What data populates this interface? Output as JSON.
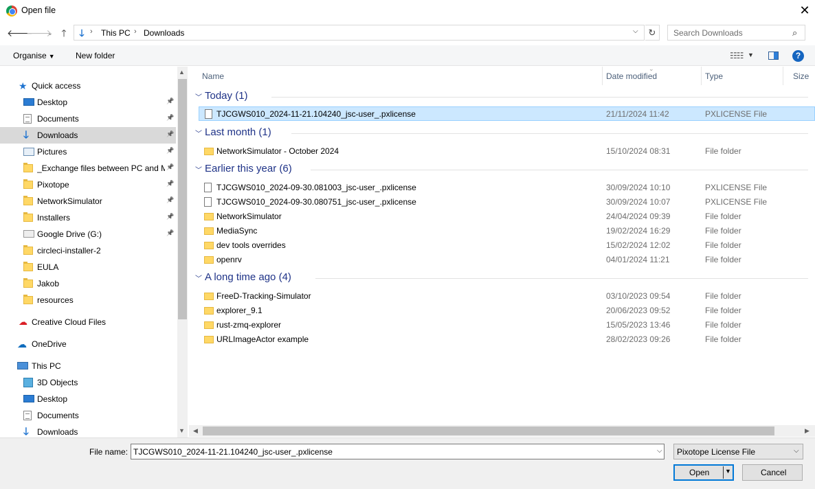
{
  "window": {
    "title": "Open file"
  },
  "nav": {
    "path": [
      "This PC",
      "Downloads"
    ],
    "search_placeholder": "Search Downloads"
  },
  "toolbar": {
    "organise": "Organise",
    "new_folder": "New folder"
  },
  "sidebar": {
    "items": [
      {
        "label": "Quick access",
        "icon": "star-icon",
        "pinned": false
      },
      {
        "label": "Desktop",
        "icon": "desktop-icon",
        "pinned": true
      },
      {
        "label": "Documents",
        "icon": "documents-icon",
        "pinned": true
      },
      {
        "label": "Downloads",
        "icon": "downloads-icon",
        "pinned": true
      },
      {
        "label": "Pictures",
        "icon": "pictures-icon",
        "pinned": true
      },
      {
        "label": "_Exchange files between PC and MA",
        "icon": "folder-icon",
        "pinned": true
      },
      {
        "label": "Pixotope",
        "icon": "folder-icon",
        "pinned": true
      },
      {
        "label": "NetworkSimulator",
        "icon": "folder-icon",
        "pinned": true
      },
      {
        "label": "Installers",
        "icon": "folder-icon",
        "pinned": true
      },
      {
        "label": "Google Drive (G:)",
        "icon": "google-drive-icon",
        "pinned": true
      },
      {
        "label": "circleci-installer-2",
        "icon": "folder-icon",
        "pinned": false
      },
      {
        "label": "EULA",
        "icon": "folder-icon",
        "pinned": false
      },
      {
        "label": "Jakob",
        "icon": "folder-icon",
        "pinned": false
      },
      {
        "label": "resources",
        "icon": "folder-icon",
        "pinned": false
      },
      {
        "label": "Creative Cloud Files",
        "icon": "creative-cloud-icon",
        "pinned": false
      },
      {
        "label": "OneDrive",
        "icon": "onedrive-icon",
        "pinned": false
      },
      {
        "label": "This PC",
        "icon": "this-pc-icon",
        "pinned": false
      },
      {
        "label": "3D Objects",
        "icon": "3d-objects-icon",
        "pinned": false
      },
      {
        "label": "Desktop",
        "icon": "desktop-icon",
        "pinned": false
      },
      {
        "label": "Documents",
        "icon": "documents-icon",
        "pinned": false
      },
      {
        "label": "Downloads",
        "icon": "downloads-icon",
        "pinned": false
      }
    ]
  },
  "columns": {
    "name": "Name",
    "date": "Date modified",
    "type": "Type",
    "size": "Size"
  },
  "groups": [
    {
      "label": "Today (1)",
      "files": [
        {
          "name": "TJCGWS010_2024-11-21.104240_jsc-user_.pxlicense",
          "date": "21/11/2024 11:42",
          "type": "PXLICENSE File",
          "kind": "file"
        }
      ]
    },
    {
      "label": "Last month (1)",
      "files": [
        {
          "name": "NetworkSimulator - October 2024",
          "date": "15/10/2024 08:31",
          "type": "File folder",
          "kind": "folder"
        }
      ]
    },
    {
      "label": "Earlier this year (6)",
      "files": [
        {
          "name": "TJCGWS010_2024-09-30.081003_jsc-user_.pxlicense",
          "date": "30/09/2024 10:10",
          "type": "PXLICENSE File",
          "kind": "file"
        },
        {
          "name": "TJCGWS010_2024-09-30.080751_jsc-user_.pxlicense",
          "date": "30/09/2024 10:07",
          "type": "PXLICENSE File",
          "kind": "file"
        },
        {
          "name": "NetworkSimulator",
          "date": "24/04/2024 09:39",
          "type": "File folder",
          "kind": "folder"
        },
        {
          "name": "MediaSync",
          "date": "19/02/2024 16:29",
          "type": "File folder",
          "kind": "folder"
        },
        {
          "name": "dev tools overrides",
          "date": "15/02/2024 12:02",
          "type": "File folder",
          "kind": "folder"
        },
        {
          "name": "openrv",
          "date": "04/01/2024 11:21",
          "type": "File folder",
          "kind": "folder"
        }
      ]
    },
    {
      "label": "A long time ago (4)",
      "files": [
        {
          "name": "FreeD-Tracking-Simulator",
          "date": "03/10/2023 09:54",
          "type": "File folder",
          "kind": "folder"
        },
        {
          "name": "explorer_9.1",
          "date": "20/06/2023 09:52",
          "type": "File folder",
          "kind": "folder"
        },
        {
          "name": "rust-zmq-explorer",
          "date": "15/05/2023 13:46",
          "type": "File folder",
          "kind": "folder"
        },
        {
          "name": "URLImageActor example",
          "date": "28/02/2023 09:26",
          "type": "File folder",
          "kind": "folder"
        }
      ]
    }
  ],
  "footer": {
    "file_name_label": "File name:",
    "file_name_value": "TJCGWS010_2024-11-21.104240_jsc-user_.pxlicense",
    "file_type": "Pixotope License File",
    "open_label": "Open",
    "cancel_label": "Cancel"
  },
  "colors": {
    "selection": "#cce8ff",
    "accent": "#0078d7",
    "group_header": "#1e3287"
  }
}
